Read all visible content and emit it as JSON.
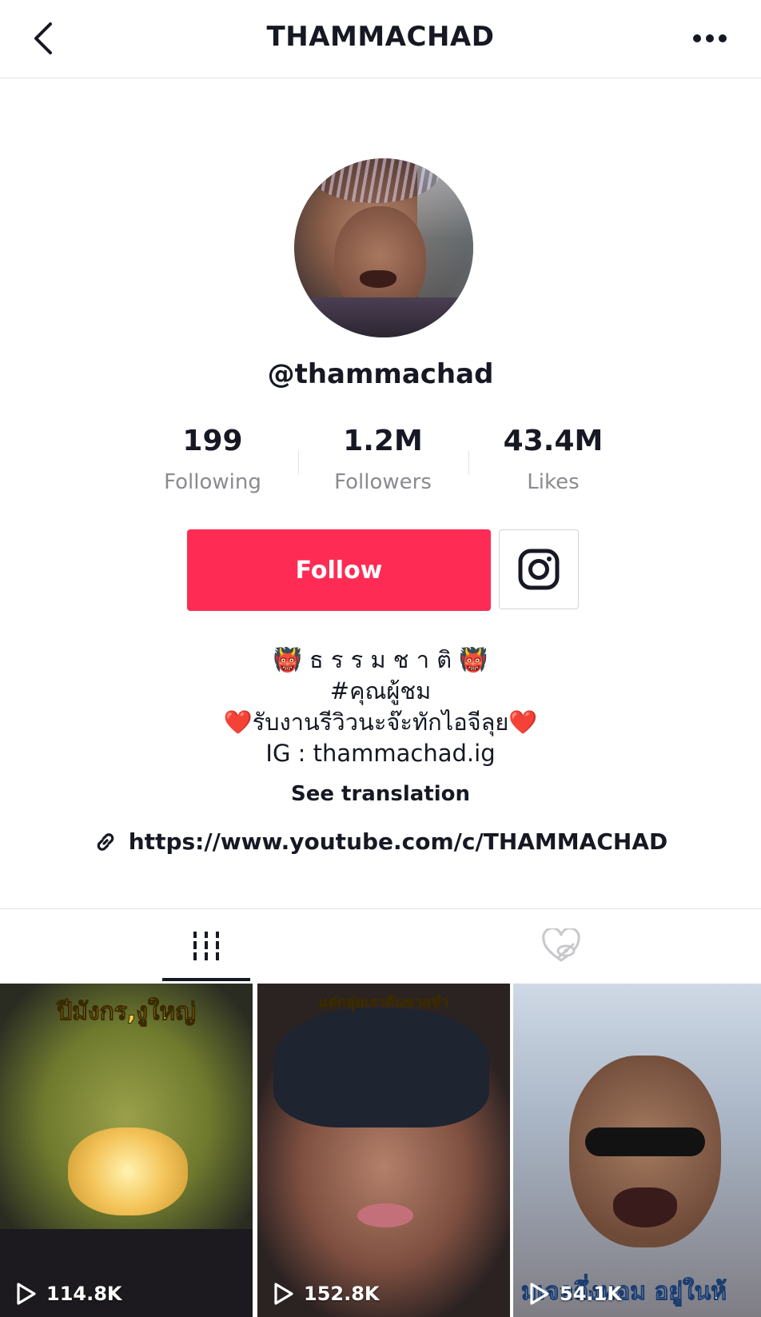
{
  "header": {
    "title": "THAMMACHAD"
  },
  "profile": {
    "username": "@thammachad"
  },
  "stats": [
    {
      "value": "199",
      "label": "Following"
    },
    {
      "value": "1.2M",
      "label": "Followers"
    },
    {
      "value": "43.4M",
      "label": "Likes"
    }
  ],
  "actions": {
    "follow_label": "Follow"
  },
  "bio": {
    "line1": "👹 ธ ร ร ม ช า ติ 👹",
    "line2": "#คุณผู้ชม",
    "line3": "❤️รับงานรีวิวนะจ๊ะทักไอจีลุย❤️",
    "line4": "IG : thammachad.ig",
    "see_translation": "See translation",
    "link": "https://www.youtube.com/c/THAMMACHAD"
  },
  "videos": [
    {
      "caption_top": "ปีมังกร,งูใหญ่",
      "caption_bottom": "",
      "views": "114.8K"
    },
    {
      "caption_top": "แต่กลุ่มเราดันขายขำ",
      "caption_bottom": "",
      "views": "152.8K"
    },
    {
      "caption_top": "",
      "caption_bottom": "มเจอถึ่งหอม อยู่ในห้",
      "views": "54.1K"
    }
  ],
  "colors": {
    "accent": "#fe2c55",
    "text": "#161823",
    "muted": "#8a8b91",
    "divider": "#e3e3e4"
  },
  "icons": {
    "back": "chevron-left-icon",
    "more": "more-horizontal-icon",
    "instagram": "instagram-icon",
    "link": "link-icon",
    "videos_tab": "grid-bars-icon",
    "liked_tab": "hidden-heart-icon",
    "play": "play-icon"
  }
}
